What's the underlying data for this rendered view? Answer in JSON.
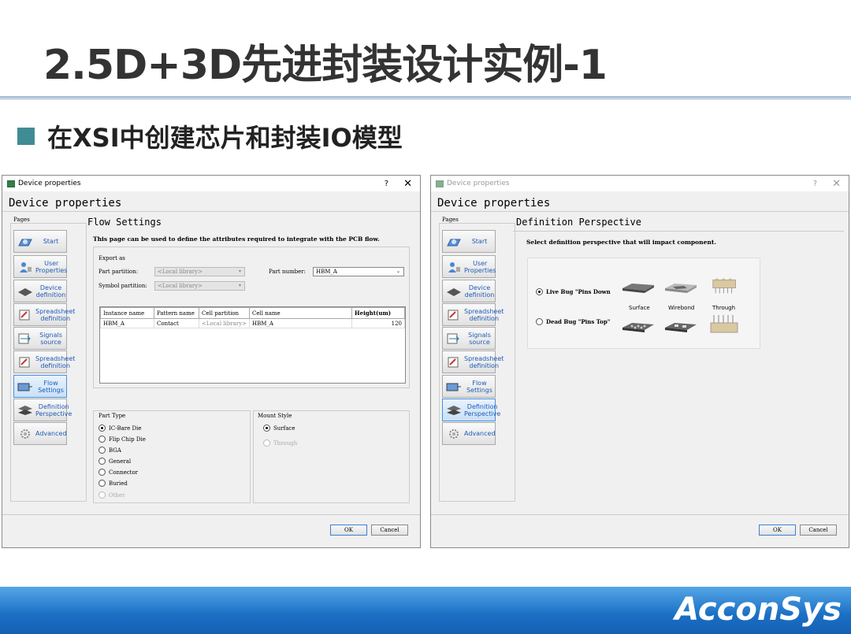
{
  "slide": {
    "title": "2.5D+3D先进封装设计实例-1",
    "subtitle": "在XSI中创建芯片和封装IO模型",
    "logo": "AcconSys"
  },
  "dialog_left": {
    "window_title": "Device properties",
    "help": "?",
    "close": "✕",
    "header": "Device properties",
    "pages_label": "Pages",
    "pages": [
      {
        "label": "Start"
      },
      {
        "label": "User Properties"
      },
      {
        "label": "Device definition"
      },
      {
        "label": "Spreadsheet definition"
      },
      {
        "label": "Signals source"
      },
      {
        "label": "Spreadsheet definition"
      },
      {
        "label": "Flow Settings",
        "selected": true
      },
      {
        "label": "Definition Perspective"
      },
      {
        "label": "Advanced"
      }
    ],
    "section_title": "Flow Settings",
    "description": "This page can be used to define the attributes required to integrate with the PCB flow.",
    "export_as": "Export as",
    "part_partition_label": "Part partition:",
    "part_partition_value": "<Local library>",
    "symbol_partition_label": "Symbol partition:",
    "symbol_partition_value": "<Local library>",
    "part_number_label": "Part number:",
    "part_number_value": "HBM_A",
    "table": {
      "columns": [
        "Instance name",
        "Pattern name",
        "Cell partition",
        "Cell name",
        "Height(um)"
      ],
      "rows": [
        [
          "HBM_A",
          "Contact",
          "<Local library>",
          "HBM_A",
          "120"
        ]
      ]
    },
    "part_type_label": "Part Type",
    "part_types": [
      "IC-Bare Die",
      "Flip Chip Die",
      "BGA",
      "General",
      "Connector",
      "Buried",
      "Other"
    ],
    "part_type_selected": "IC-Bare Die",
    "mount_style_label": "Mount Style",
    "mount_styles": [
      "Surface",
      "Through"
    ],
    "ok": "OK",
    "cancel": "Cancel"
  },
  "dialog_right": {
    "window_title": "Device properties",
    "help": "?",
    "close": "✕",
    "header": "Device properties",
    "pages_label": "Pages",
    "section_title": "Definition Perspective",
    "description": "Select definition perspective that will impact component.",
    "option_live": "Live Bug \"Pins Down",
    "option_dead": "Dead Bug \"Pins Top\"",
    "captions": [
      "Surface",
      "Wirebond",
      "Through"
    ],
    "ok": "OK",
    "cancel": "Cancel"
  }
}
